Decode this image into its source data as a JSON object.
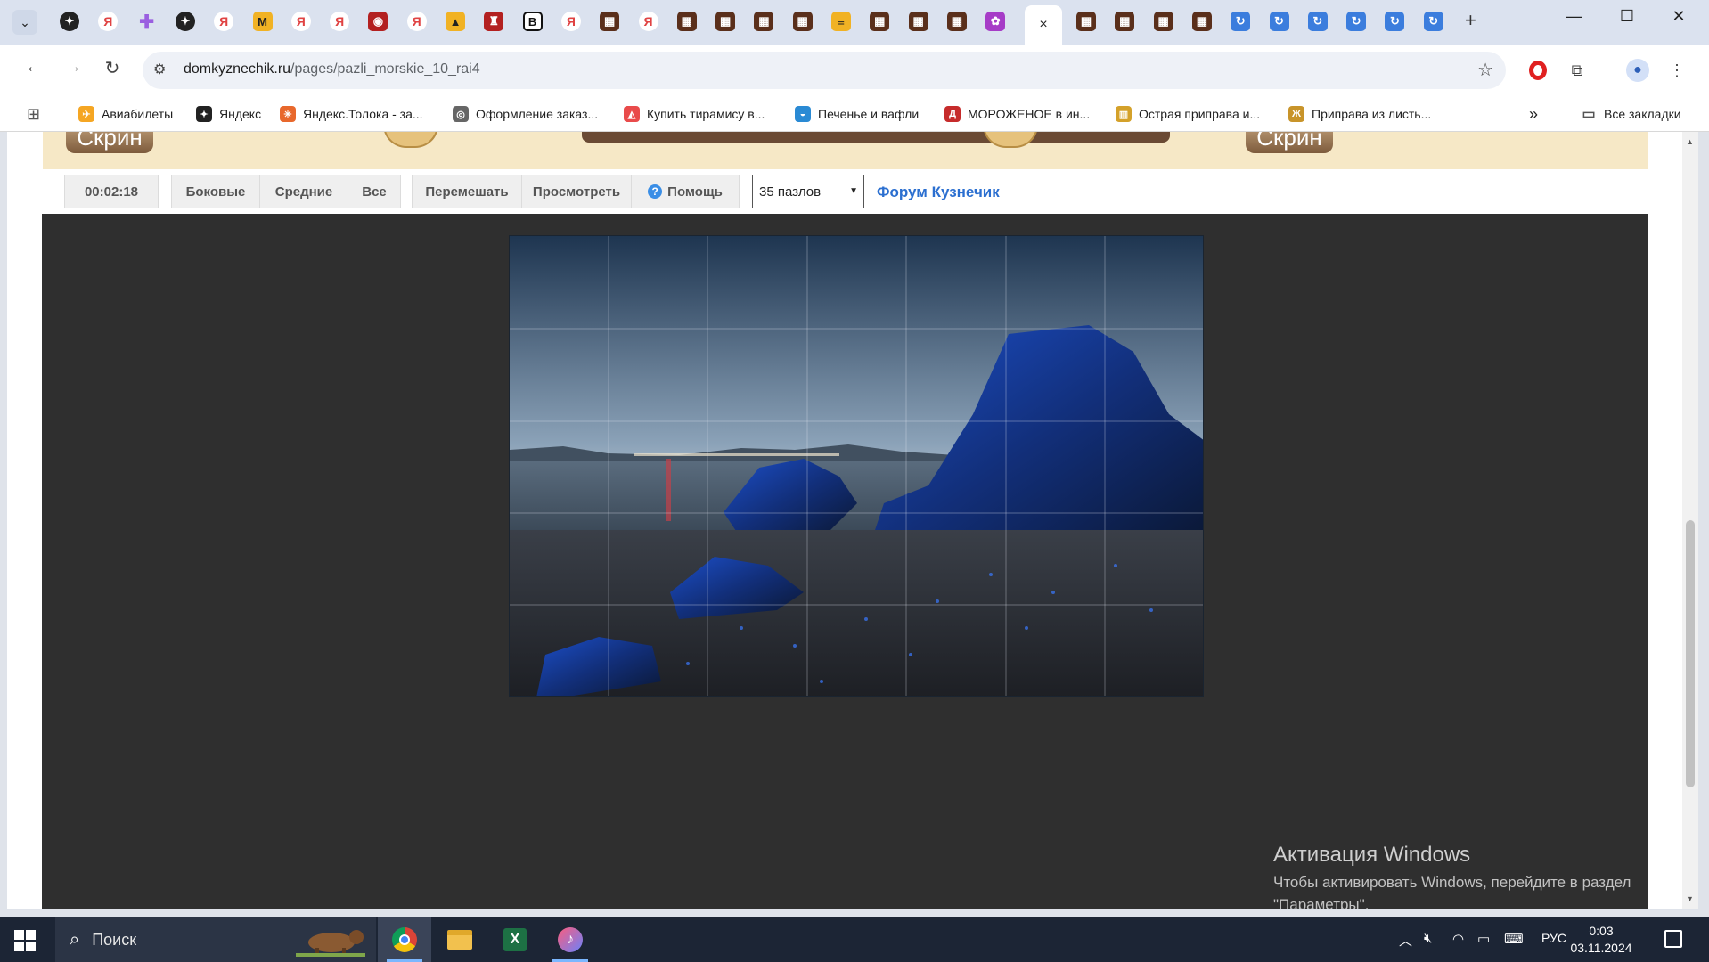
{
  "browser": {
    "tabs_menu_icon": "chevron-down-icon",
    "tabs": [
      {
        "icon": "dark-star",
        "glyph": "✦"
      },
      {
        "icon": "yandex",
        "glyph": "Я"
      },
      {
        "icon": "plus-purple",
        "glyph": "✚"
      },
      {
        "icon": "dark-star",
        "glyph": "✦"
      },
      {
        "icon": "yandex",
        "glyph": "Я"
      },
      {
        "icon": "amber",
        "glyph": "M"
      },
      {
        "icon": "yandex",
        "glyph": "Я"
      },
      {
        "icon": "yandex",
        "glyph": "Я"
      },
      {
        "icon": "red",
        "glyph": "◉"
      },
      {
        "icon": "yandex",
        "glyph": "Я"
      },
      {
        "icon": "amber",
        "glyph": "▲"
      },
      {
        "icon": "red",
        "glyph": "♜"
      },
      {
        "icon": "b-letter",
        "glyph": "B"
      },
      {
        "icon": "yandex",
        "glyph": "Я"
      },
      {
        "icon": "brown",
        "glyph": "▦"
      },
      {
        "icon": "yandex",
        "glyph": "Я"
      },
      {
        "icon": "brown",
        "glyph": "▦"
      },
      {
        "icon": "brown",
        "glyph": "▦"
      },
      {
        "icon": "brown",
        "glyph": "▦"
      },
      {
        "icon": "brown",
        "glyph": "▦"
      },
      {
        "icon": "amber",
        "glyph": "≡"
      },
      {
        "icon": "brown",
        "glyph": "▦"
      },
      {
        "icon": "brown",
        "glyph": "▦"
      },
      {
        "icon": "brown",
        "glyph": "▦"
      },
      {
        "icon": "purple",
        "glyph": "✿"
      }
    ],
    "active_tab_close": "×",
    "tabs_after": [
      {
        "icon": "brown",
        "glyph": "▦"
      },
      {
        "icon": "brown",
        "glyph": "▦"
      },
      {
        "icon": "brown",
        "glyph": "▦"
      },
      {
        "icon": "brown",
        "glyph": "▦"
      },
      {
        "icon": "blue",
        "glyph": "↻"
      },
      {
        "icon": "blue",
        "glyph": "↻"
      },
      {
        "icon": "blue",
        "glyph": "↻"
      },
      {
        "icon": "blue",
        "glyph": "↻"
      },
      {
        "icon": "blue",
        "glyph": "↻"
      },
      {
        "icon": "blue",
        "glyph": "↻"
      }
    ],
    "new_tab": "+",
    "window_controls": {
      "minimize": "—",
      "maximize": "☐",
      "close": "✕"
    },
    "nav": {
      "back": "←",
      "forward": "→",
      "reload": "↻"
    },
    "url_host": "domkyznechik.ru",
    "url_path": "/pages/pazli_morskie_10_rai4",
    "star": "☆",
    "bookmarks": [
      {
        "label": "Авиабилеты",
        "icon": "flame-icon",
        "color": "#f5a623",
        "glyph": "✈"
      },
      {
        "label": "Яндекс",
        "icon": "yandex-star-icon",
        "color": "#222222",
        "glyph": "✦"
      },
      {
        "label": "Яндекс.Толока - за...",
        "icon": "toloka-icon",
        "color": "#e8682c",
        "glyph": "✳"
      },
      {
        "label": "Оформление заказ...",
        "icon": "globe-icon",
        "color": "#666666",
        "glyph": "◎"
      },
      {
        "label": "Купить тирамису в...",
        "icon": "cake-icon",
        "color": "#e94b4b",
        "glyph": "◭"
      },
      {
        "label": "Печенье и вафли",
        "icon": "basket-icon",
        "color": "#2a8ad4",
        "glyph": "◒"
      },
      {
        "label": "МОРОЖЕНОЕ в ин...",
        "icon": "d-icon",
        "color": "#c62b2b",
        "glyph": "Д"
      },
      {
        "label": "Острая приправа и...",
        "icon": "shop-icon",
        "color": "#d4a12a",
        "glyph": "▥"
      },
      {
        "label": "Приправа из листь...",
        "icon": "zh-icon",
        "color": "#c8942a",
        "glyph": "Ж"
      }
    ],
    "bookmarks_overflow": "»",
    "all_bookmarks": "Все закладки"
  },
  "page": {
    "banner_left": "Скрин",
    "banner_right": "Скрин",
    "timer": "00:02:18",
    "filters": [
      "Боковые",
      "Средние",
      "Все"
    ],
    "actions": {
      "shuffle": "Перемешать",
      "preview": "Просмотреть",
      "help": "Помощь"
    },
    "pieces_select": "35 пазлов",
    "forum_link": "Форум Кузнечик",
    "puzzle": {
      "rows": 5,
      "cols": 7
    }
  },
  "watermark": {
    "title": "Активация Windows",
    "line1": "Чтобы активировать Windows, перейдите в раздел",
    "line2": "\"Параметры\"."
  },
  "taskbar": {
    "search_label": "Поиск",
    "tray_lang": "РУС",
    "time": "0:03",
    "date": "03.11.2024"
  }
}
